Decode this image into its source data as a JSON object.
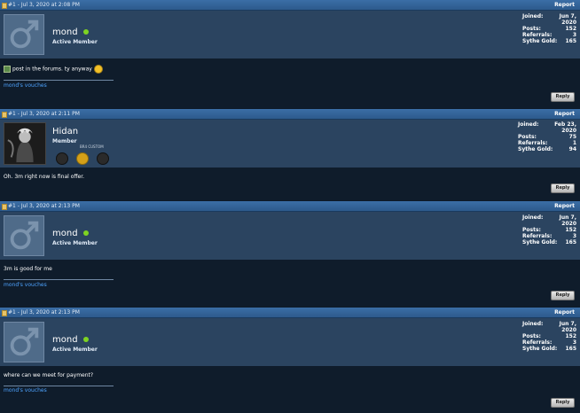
{
  "posts": [
    {
      "date": "#1 - Jul 3, 2020 at 2:08 PM",
      "report": "Report",
      "username": "mond",
      "user_title": "Active Member",
      "stats": {
        "joined_label": "Joined:",
        "joined": "Jun 7, 2020",
        "posts_label": "Posts:",
        "posts": "152",
        "referrals_label": "Referrals:",
        "referrals": "3",
        "gold_label": "Sythe Gold:",
        "gold": "165"
      },
      "message": "post in the forums. ty anyway",
      "vouches": "mond's vouches",
      "reply": "Reply"
    },
    {
      "date": "#1 - Jul 3, 2020 at 2:11 PM",
      "report": "Report",
      "username": "Hidan",
      "user_title": "Member",
      "badge_label": "BR4 CUSTOM",
      "stats": {
        "joined_label": "Joined:",
        "joined": "Feb 23, 2020",
        "posts_label": "Posts:",
        "posts": "75",
        "referrals_label": "Referrals:",
        "referrals": "1",
        "gold_label": "Sythe Gold:",
        "gold": "94"
      },
      "message": "Oh. 3m right now is final offer.",
      "reply": "Reply"
    },
    {
      "date": "#1 - Jul 3, 2020 at 2:13 PM",
      "report": "Report",
      "username": "mond",
      "user_title": "Active Member",
      "stats": {
        "joined_label": "Joined:",
        "joined": "Jun 7, 2020",
        "posts_label": "Posts:",
        "posts": "152",
        "referrals_label": "Referrals:",
        "referrals": "3",
        "gold_label": "Sythe Gold:",
        "gold": "165"
      },
      "message": "3m is good for me",
      "vouches": "mond's vouches",
      "reply": "Reply"
    },
    {
      "date": "#1 - Jul 3, 2020 at 2:13 PM",
      "report": "Report",
      "username": "mond",
      "user_title": "Active Member",
      "stats": {
        "joined_label": "Joined:",
        "joined": "Jun 7, 2020",
        "posts_label": "Posts:",
        "posts": "152",
        "referrals_label": "Referrals:",
        "referrals": "3",
        "gold_label": "Sythe Gold:",
        "gold": "165"
      },
      "message": "where can we meet for payment?",
      "vouches": "mond's vouches",
      "reply": "Reply"
    }
  ],
  "colors": {
    "header": "#2d5a8c",
    "user_panel": "#2b4460",
    "body": "#0f1c2b",
    "link": "#4da3ff",
    "online": "#7ed321"
  }
}
